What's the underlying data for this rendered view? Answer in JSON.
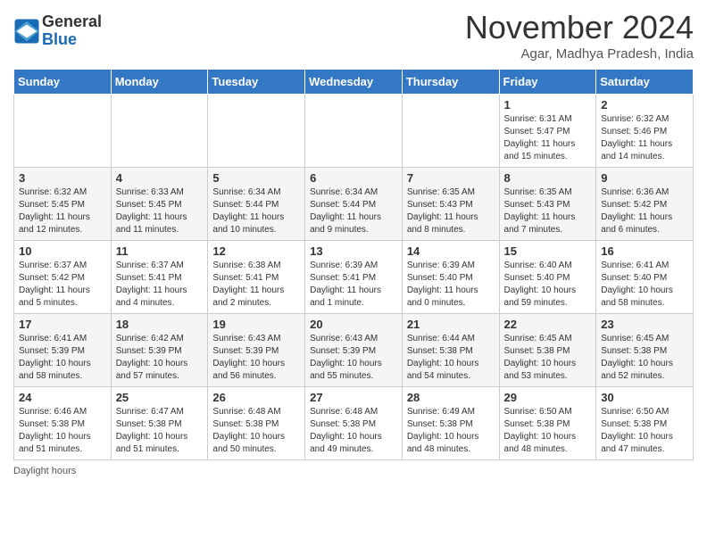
{
  "logo": {
    "text_general": "General",
    "text_blue": "Blue"
  },
  "title": "November 2024",
  "location": "Agar, Madhya Pradesh, India",
  "days_of_week": [
    "Sunday",
    "Monday",
    "Tuesday",
    "Wednesday",
    "Thursday",
    "Friday",
    "Saturday"
  ],
  "footer": "Daylight hours",
  "weeks": [
    [
      {
        "day": "",
        "info": ""
      },
      {
        "day": "",
        "info": ""
      },
      {
        "day": "",
        "info": ""
      },
      {
        "day": "",
        "info": ""
      },
      {
        "day": "",
        "info": ""
      },
      {
        "day": "1",
        "info": "Sunrise: 6:31 AM\nSunset: 5:47 PM\nDaylight: 11 hours and 15 minutes."
      },
      {
        "day": "2",
        "info": "Sunrise: 6:32 AM\nSunset: 5:46 PM\nDaylight: 11 hours and 14 minutes."
      }
    ],
    [
      {
        "day": "3",
        "info": "Sunrise: 6:32 AM\nSunset: 5:45 PM\nDaylight: 11 hours and 12 minutes."
      },
      {
        "day": "4",
        "info": "Sunrise: 6:33 AM\nSunset: 5:45 PM\nDaylight: 11 hours and 11 minutes."
      },
      {
        "day": "5",
        "info": "Sunrise: 6:34 AM\nSunset: 5:44 PM\nDaylight: 11 hours and 10 minutes."
      },
      {
        "day": "6",
        "info": "Sunrise: 6:34 AM\nSunset: 5:44 PM\nDaylight: 11 hours and 9 minutes."
      },
      {
        "day": "7",
        "info": "Sunrise: 6:35 AM\nSunset: 5:43 PM\nDaylight: 11 hours and 8 minutes."
      },
      {
        "day": "8",
        "info": "Sunrise: 6:35 AM\nSunset: 5:43 PM\nDaylight: 11 hours and 7 minutes."
      },
      {
        "day": "9",
        "info": "Sunrise: 6:36 AM\nSunset: 5:42 PM\nDaylight: 11 hours and 6 minutes."
      }
    ],
    [
      {
        "day": "10",
        "info": "Sunrise: 6:37 AM\nSunset: 5:42 PM\nDaylight: 11 hours and 5 minutes."
      },
      {
        "day": "11",
        "info": "Sunrise: 6:37 AM\nSunset: 5:41 PM\nDaylight: 11 hours and 4 minutes."
      },
      {
        "day": "12",
        "info": "Sunrise: 6:38 AM\nSunset: 5:41 PM\nDaylight: 11 hours and 2 minutes."
      },
      {
        "day": "13",
        "info": "Sunrise: 6:39 AM\nSunset: 5:41 PM\nDaylight: 11 hours and 1 minute."
      },
      {
        "day": "14",
        "info": "Sunrise: 6:39 AM\nSunset: 5:40 PM\nDaylight: 11 hours and 0 minutes."
      },
      {
        "day": "15",
        "info": "Sunrise: 6:40 AM\nSunset: 5:40 PM\nDaylight: 10 hours and 59 minutes."
      },
      {
        "day": "16",
        "info": "Sunrise: 6:41 AM\nSunset: 5:40 PM\nDaylight: 10 hours and 58 minutes."
      }
    ],
    [
      {
        "day": "17",
        "info": "Sunrise: 6:41 AM\nSunset: 5:39 PM\nDaylight: 10 hours and 58 minutes."
      },
      {
        "day": "18",
        "info": "Sunrise: 6:42 AM\nSunset: 5:39 PM\nDaylight: 10 hours and 57 minutes."
      },
      {
        "day": "19",
        "info": "Sunrise: 6:43 AM\nSunset: 5:39 PM\nDaylight: 10 hours and 56 minutes."
      },
      {
        "day": "20",
        "info": "Sunrise: 6:43 AM\nSunset: 5:39 PM\nDaylight: 10 hours and 55 minutes."
      },
      {
        "day": "21",
        "info": "Sunrise: 6:44 AM\nSunset: 5:38 PM\nDaylight: 10 hours and 54 minutes."
      },
      {
        "day": "22",
        "info": "Sunrise: 6:45 AM\nSunset: 5:38 PM\nDaylight: 10 hours and 53 minutes."
      },
      {
        "day": "23",
        "info": "Sunrise: 6:45 AM\nSunset: 5:38 PM\nDaylight: 10 hours and 52 minutes."
      }
    ],
    [
      {
        "day": "24",
        "info": "Sunrise: 6:46 AM\nSunset: 5:38 PM\nDaylight: 10 hours and 51 minutes."
      },
      {
        "day": "25",
        "info": "Sunrise: 6:47 AM\nSunset: 5:38 PM\nDaylight: 10 hours and 51 minutes."
      },
      {
        "day": "26",
        "info": "Sunrise: 6:48 AM\nSunset: 5:38 PM\nDaylight: 10 hours and 50 minutes."
      },
      {
        "day": "27",
        "info": "Sunrise: 6:48 AM\nSunset: 5:38 PM\nDaylight: 10 hours and 49 minutes."
      },
      {
        "day": "28",
        "info": "Sunrise: 6:49 AM\nSunset: 5:38 PM\nDaylight: 10 hours and 48 minutes."
      },
      {
        "day": "29",
        "info": "Sunrise: 6:50 AM\nSunset: 5:38 PM\nDaylight: 10 hours and 48 minutes."
      },
      {
        "day": "30",
        "info": "Sunrise: 6:50 AM\nSunset: 5:38 PM\nDaylight: 10 hours and 47 minutes."
      }
    ]
  ]
}
